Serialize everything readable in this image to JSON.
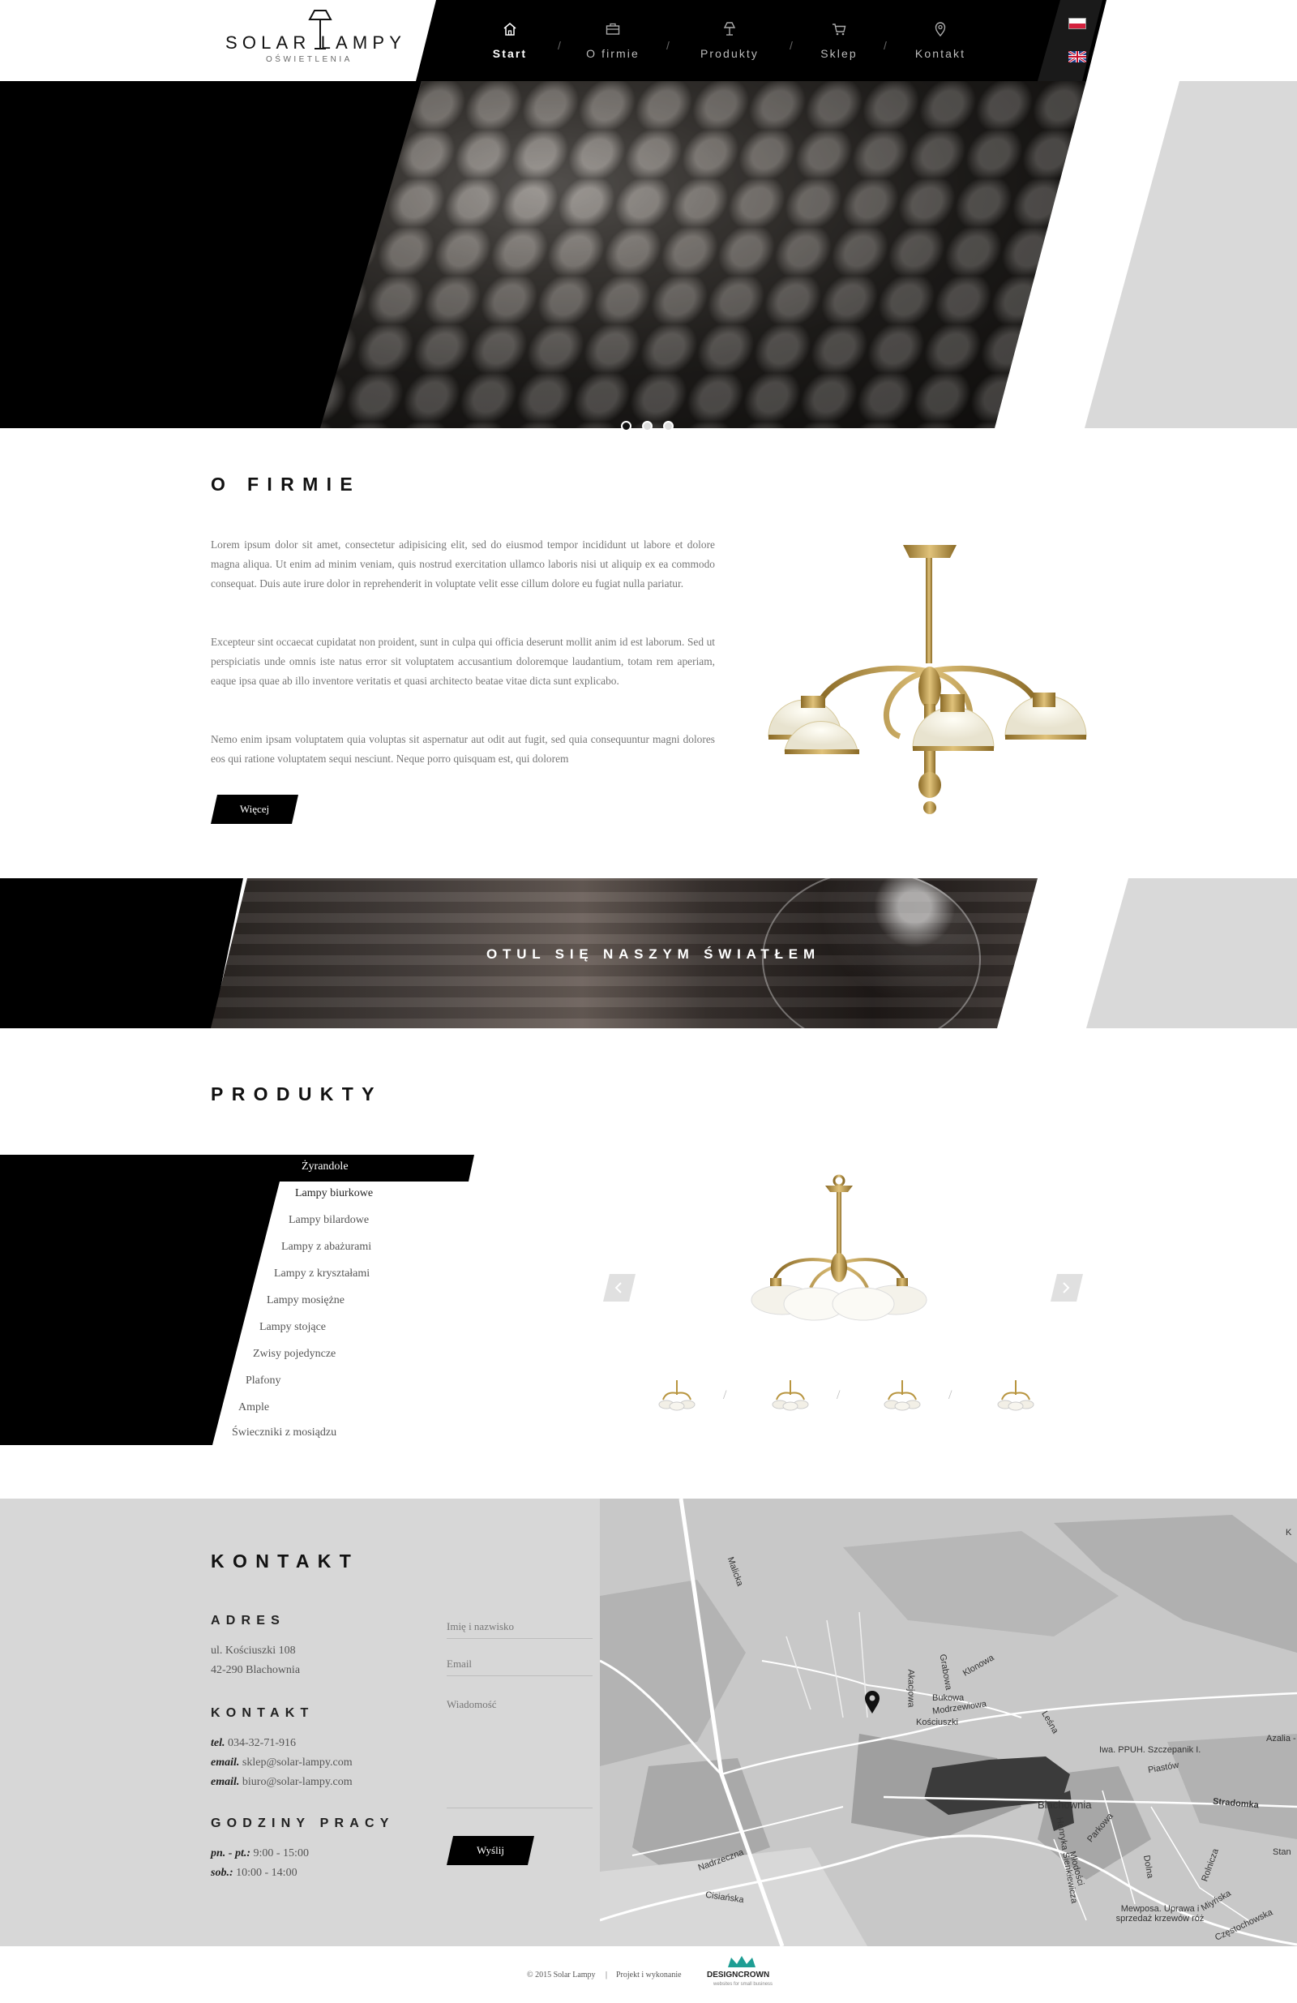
{
  "header": {
    "logo": {
      "brand": "SOLAR LAMPY",
      "subtitle": "OŚWIETLENIA"
    },
    "nav": [
      {
        "label": "Start",
        "icon": "home-icon",
        "active": true
      },
      {
        "label": "O firmie",
        "icon": "briefcase-icon",
        "active": false
      },
      {
        "label": "Produkty",
        "icon": "lamp-icon",
        "active": false
      },
      {
        "label": "Sklep",
        "icon": "cart-icon",
        "active": false
      },
      {
        "label": "Kontakt",
        "icon": "map-pin-icon",
        "active": false
      }
    ],
    "languages": [
      {
        "code": "pl",
        "icon": "poland-flag-icon"
      },
      {
        "code": "en",
        "icon": "uk-flag-icon"
      }
    ]
  },
  "hero": {
    "slides": 3,
    "active_slide": 1
  },
  "about": {
    "title": "O FIRMIE",
    "paragraphs": [
      "Lorem ipsum dolor sit amet, consectetur adipisicing elit, sed do eiusmod tempor incididunt ut labore et dolore magna aliqua. Ut enim ad minim veniam, quis nostrud exercitation ullamco laboris nisi ut aliquip ex ea commodo consequat. Duis aute irure dolor in reprehenderit in voluptate velit esse cillum dolore eu fugiat nulla pariatur.",
      "Excepteur sint occaecat cupidatat non proident, sunt in culpa qui officia deserunt mollit anim id est laborum. Sed ut perspiciatis unde omnis iste natus error sit voluptatem accusantium doloremque laudantium, totam rem aperiam, eaque ipsa quae ab illo inventore veritatis et quasi architecto beatae vitae dicta sunt explicabo.",
      "Nemo enim ipsam voluptatem quia voluptas sit aspernatur aut odit aut fugit, sed quia consequuntur magni dolores eos qui ratione voluptatem sequi nesciunt. Neque porro quisquam est, qui dolorem"
    ],
    "more_label": "Więcej"
  },
  "band": {
    "text": "OTUL SIĘ NASZYM ŚWIATŁEM"
  },
  "products": {
    "title": "PRODUKTY",
    "categories": [
      "Żyrandole",
      "Lampy biurkowe",
      "Lampy bilardowe",
      "Lampy z abażurami",
      "Lampy z kryształami",
      "Lampy mosiężne",
      "Lampy stojące",
      "Zwisy pojedyncze",
      "Plafony",
      "Ample",
      "Świeczniki z mosiądzu"
    ],
    "active_category": 0,
    "thumbnails": 4
  },
  "contact": {
    "title": "KONTAKT",
    "address_heading": "ADRES",
    "address_lines": [
      "ul. Kościuszki 108",
      "42-290 Blachownia"
    ],
    "contact_heading": "KONTAKT",
    "phone_label": "tel.",
    "phone": "034-32-71-916",
    "email_label": "email.",
    "email1": "sklep@solar-lampy.com",
    "email2": "biuro@solar-lampy.com",
    "hours_heading": "GODZINY PRACY",
    "hours": [
      {
        "label": "pn. - pt.:",
        "value": "9:00 - 15:00"
      },
      {
        "label": "sob.:",
        "value": "10:00 - 14:00"
      }
    ],
    "form": {
      "name_placeholder": "Imię i nazwisko",
      "email_placeholder": "Email",
      "message_placeholder": "Wiadomość",
      "submit_label": "Wyślij"
    },
    "map_labels": [
      "Malicka",
      "Akacjowa",
      "Grabowa",
      "Klonowa",
      "Bukowa",
      "Modrzewiowa",
      "Kościuszki",
      "Leśna",
      "Iwa. PPUH. Szczepanik I.",
      "Azalia -",
      "Piastów",
      "Stradomka",
      "Blachownia",
      "Parkowa",
      "Henryka Sienkiewicza",
      "Dolna",
      "Młodości",
      "Nadrzeczna",
      "Cisiańska",
      "Mewposa. Uprawa i sprzedaż krzewów róż",
      "Rolnicza",
      "Miyńska",
      "Częstochowska",
      "Stan",
      "K"
    ]
  },
  "footer": {
    "copyright": "© 2015 Solar Lampy",
    "separator": "|",
    "credit": "Projekt i wykonanie",
    "agency": "DESIGNCROWN",
    "agency_tagline": "websites for small business"
  }
}
